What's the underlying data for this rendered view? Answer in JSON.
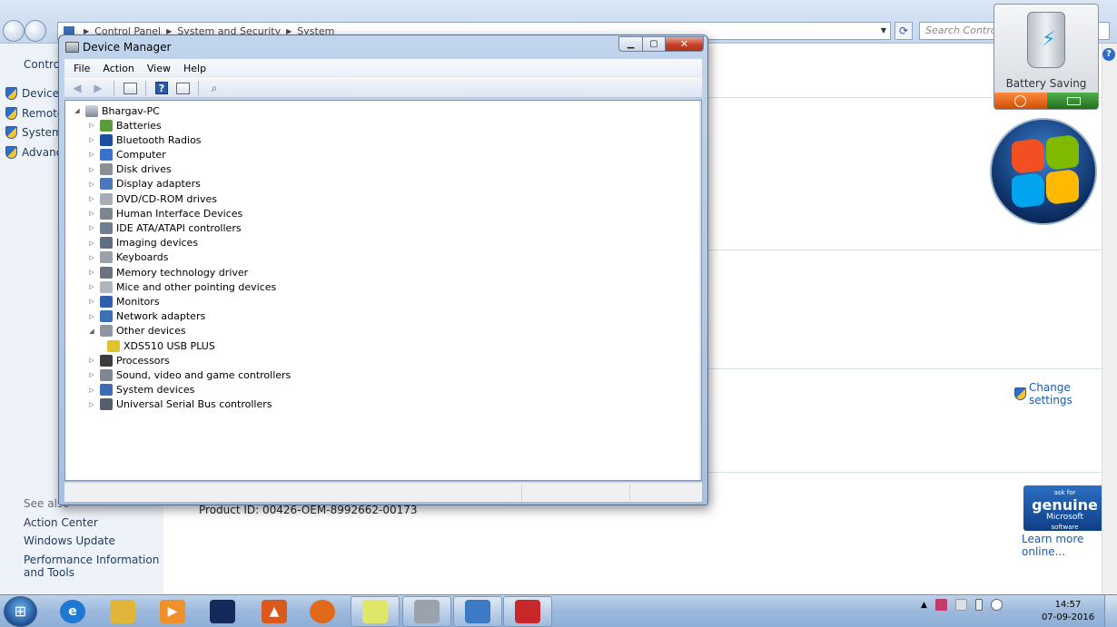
{
  "control_panel": {
    "breadcrumb": [
      "Control Panel",
      "System and Security",
      "System"
    ],
    "search_placeholder": "Search Control P...",
    "home_label": "Control",
    "tasks": [
      "Device M",
      "Remote",
      "System",
      "Advanc"
    ],
    "see_also_label": "See also",
    "see_also_links": [
      "Action Center",
      "Windows Update",
      "Performance Information and Tools"
    ],
    "product_id": "Product ID:  00426-OEM-8992662-00173",
    "change_settings": "Change settings",
    "learn_more": "Learn more online...",
    "genuine": {
      "line1": "ask for",
      "line2": "genuine",
      "line3": "Microsoft",
      "line4": "software"
    }
  },
  "battery_gadget": {
    "label": "Battery Saving"
  },
  "device_manager": {
    "title": "Device Manager",
    "menu": [
      "File",
      "Action",
      "View",
      "Help"
    ],
    "root": "Bhargav-PC",
    "nodes": [
      {
        "label": "Batteries",
        "expanded": false,
        "color": "#5a9c3a"
      },
      {
        "label": "Bluetooth Radios",
        "expanded": false,
        "color": "#1d4f9c"
      },
      {
        "label": "Computer",
        "expanded": false,
        "color": "#3a73c9"
      },
      {
        "label": "Disk drives",
        "expanded": false,
        "color": "#8a8f96"
      },
      {
        "label": "Display adapters",
        "expanded": false,
        "color": "#4a78b8"
      },
      {
        "label": "DVD/CD-ROM drives",
        "expanded": false,
        "color": "#a7adb5"
      },
      {
        "label": "Human Interface Devices",
        "expanded": false,
        "color": "#7d8793"
      },
      {
        "label": "IDE ATA/ATAPI controllers",
        "expanded": false,
        "color": "#6f7f92"
      },
      {
        "label": "Imaging devices",
        "expanded": false,
        "color": "#5f6e80"
      },
      {
        "label": "Keyboards",
        "expanded": false,
        "color": "#9aa1aa"
      },
      {
        "label": "Memory technology driver",
        "expanded": false,
        "color": "#6a7480"
      },
      {
        "label": "Mice and other pointing devices",
        "expanded": false,
        "color": "#b0b6bd"
      },
      {
        "label": "Monitors",
        "expanded": false,
        "color": "#2f5fae"
      },
      {
        "label": "Network adapters",
        "expanded": false,
        "color": "#3c6fb4"
      },
      {
        "label": "Other devices",
        "expanded": true,
        "color": "#8d96a2"
      },
      {
        "label": "XDS510 USB PLUS",
        "child": true,
        "color": "#e3c12a"
      },
      {
        "label": "Processors",
        "expanded": false,
        "color": "#3c3c3c"
      },
      {
        "label": "Sound, video and game controllers",
        "expanded": false,
        "color": "#7e8893"
      },
      {
        "label": "System devices",
        "expanded": false,
        "color": "#3b6cb5"
      },
      {
        "label": "Universal Serial Bus controllers",
        "expanded": false,
        "color": "#555f6b"
      }
    ]
  },
  "taskbar": {
    "clock_time": "14:57",
    "clock_date": "07-09-2016",
    "buttons": [
      {
        "name": "internet-explorer",
        "color": "#1f78d1",
        "glyph": "e"
      },
      {
        "name": "windows-explorer",
        "color": "#e1b53a",
        "glyph": ""
      },
      {
        "name": "media-player",
        "color": "#f0902a",
        "glyph": "▶"
      },
      {
        "name": "aurora-app",
        "color": "#152a5a",
        "glyph": ""
      },
      {
        "name": "matlab",
        "color": "#d95a1c",
        "glyph": "▲"
      },
      {
        "name": "firefox",
        "color": "#e06a1c",
        "glyph": ""
      },
      {
        "name": "sticky-notes",
        "color": "#dfe76a",
        "glyph": ""
      },
      {
        "name": "package-app",
        "color": "#9aa2ac",
        "glyph": ""
      },
      {
        "name": "device-manager",
        "color": "#3c7ac6",
        "glyph": ""
      },
      {
        "name": "toolbox-app",
        "color": "#c8282a",
        "glyph": ""
      }
    ]
  }
}
